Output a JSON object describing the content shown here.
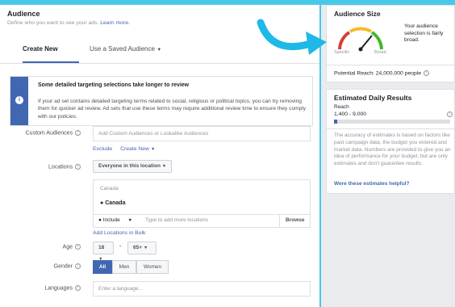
{
  "colors": {
    "accent": "#4267b2",
    "background": "#48c9ea",
    "gauge_red": "#d83b3b",
    "gauge_yellow": "#f7b928",
    "gauge_green": "#42b72a"
  },
  "audience": {
    "title": "Audience",
    "subtitle": "Define who you want to see your ads.",
    "learn_more": "Learn more.",
    "tabs": [
      {
        "label": "Create New",
        "active": true
      },
      {
        "label": "Use a Saved Audience",
        "active": false
      }
    ],
    "notice": {
      "title": "Some detailed targeting selections take longer to review",
      "body": "If your ad set contains detailed targeting terms related to social, religious or political topics, you can try removing them for quicker ad review. Ad sets that use these terms may require additional review time to ensure they comply with our policies.",
      "icon": "info-icon"
    },
    "custom_audiences": {
      "label": "Custom Audiences",
      "placeholder": "Add Custom Audiences or Lookalike Audiences",
      "exclude": "Exclude",
      "create_new": "Create New"
    },
    "locations": {
      "label": "Locations",
      "dropdown": "Everyone in this location",
      "country_header": "Canada",
      "selected": "Canada",
      "include": "Include",
      "placeholder": "Type to add more locations",
      "browse": "Browse",
      "add_bulk": "Add Locations in Bulk"
    },
    "age": {
      "label": "Age",
      "min": "18",
      "separator": "-",
      "max": "65+"
    },
    "gender": {
      "label": "Gender",
      "options": [
        "All",
        "Men",
        "Women"
      ],
      "selected": "All"
    },
    "languages": {
      "label": "Languages",
      "placeholder": "Enter a language..."
    }
  },
  "audience_size": {
    "title": "Audience Size",
    "description": "Your audience selection is fairly broad.",
    "specific": "Specific",
    "broad": "Broad",
    "gauge_level": 0.72,
    "potential_reach": "Potential Reach: 24,000,000 people"
  },
  "daily_results": {
    "title": "Estimated Daily Results",
    "reach_label": "Reach",
    "reach_value": "1,400 - 9,000",
    "reach_fill": 0.03,
    "disclaimer": "The accuracy of estimates is based on factors like past campaign data, the budget you entered and market data. Numbers are provided to give you an idea of performance for your budget, but are only estimates and don't guarantee results.",
    "helpful_link": "Were these estimates helpful?"
  }
}
